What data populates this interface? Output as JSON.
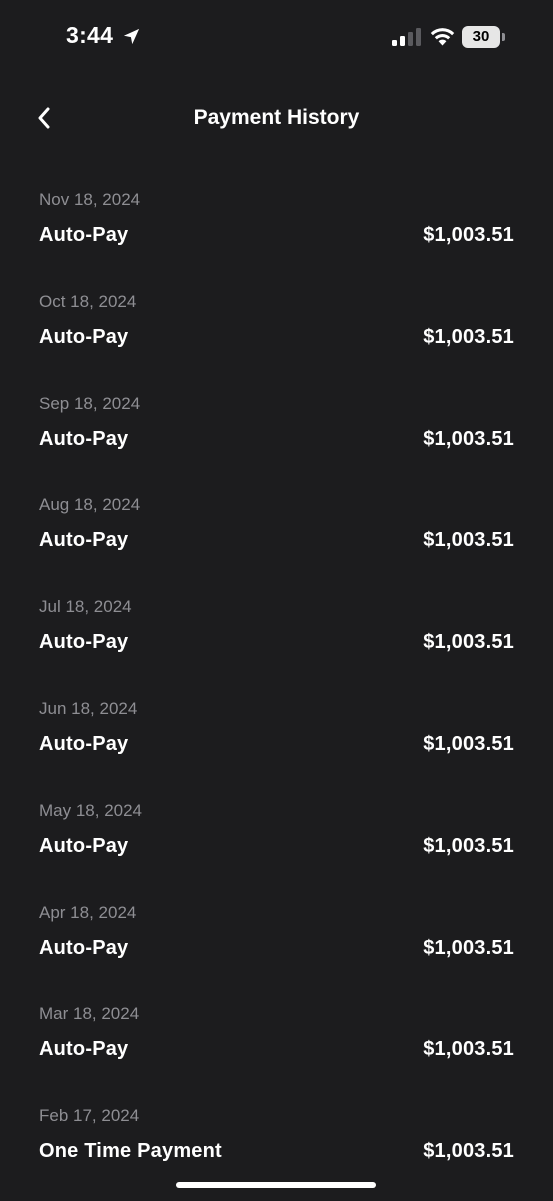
{
  "status_bar": {
    "time": "3:44",
    "battery_level": "30",
    "location_icon": "location-arrow-icon",
    "signal_icon": "cellular-signal-icon",
    "signal_bars": 2,
    "wifi_icon": "wifi-icon"
  },
  "header": {
    "title": "Payment History",
    "back_icon": "chevron-left-icon"
  },
  "payments": [
    {
      "date": "Nov 18, 2024",
      "type": "Auto-Pay",
      "amount": "$1,003.51"
    },
    {
      "date": "Oct 18, 2024",
      "type": "Auto-Pay",
      "amount": "$1,003.51"
    },
    {
      "date": "Sep 18, 2024",
      "type": "Auto-Pay",
      "amount": "$1,003.51"
    },
    {
      "date": "Aug 18, 2024",
      "type": "Auto-Pay",
      "amount": "$1,003.51"
    },
    {
      "date": "Jul 18, 2024",
      "type": "Auto-Pay",
      "amount": "$1,003.51"
    },
    {
      "date": "Jun 18, 2024",
      "type": "Auto-Pay",
      "amount": "$1,003.51"
    },
    {
      "date": "May 18, 2024",
      "type": "Auto-Pay",
      "amount": "$1,003.51"
    },
    {
      "date": "Apr 18, 2024",
      "type": "Auto-Pay",
      "amount": "$1,003.51"
    },
    {
      "date": "Mar 18, 2024",
      "type": "Auto-Pay",
      "amount": "$1,003.51"
    },
    {
      "date": "Feb 17, 2024",
      "type": "One Time Payment",
      "amount": "$1,003.51"
    }
  ],
  "colors": {
    "background": "#1c1c1e",
    "primary_text": "#ffffff",
    "secondary_text": "#8e8e93"
  }
}
